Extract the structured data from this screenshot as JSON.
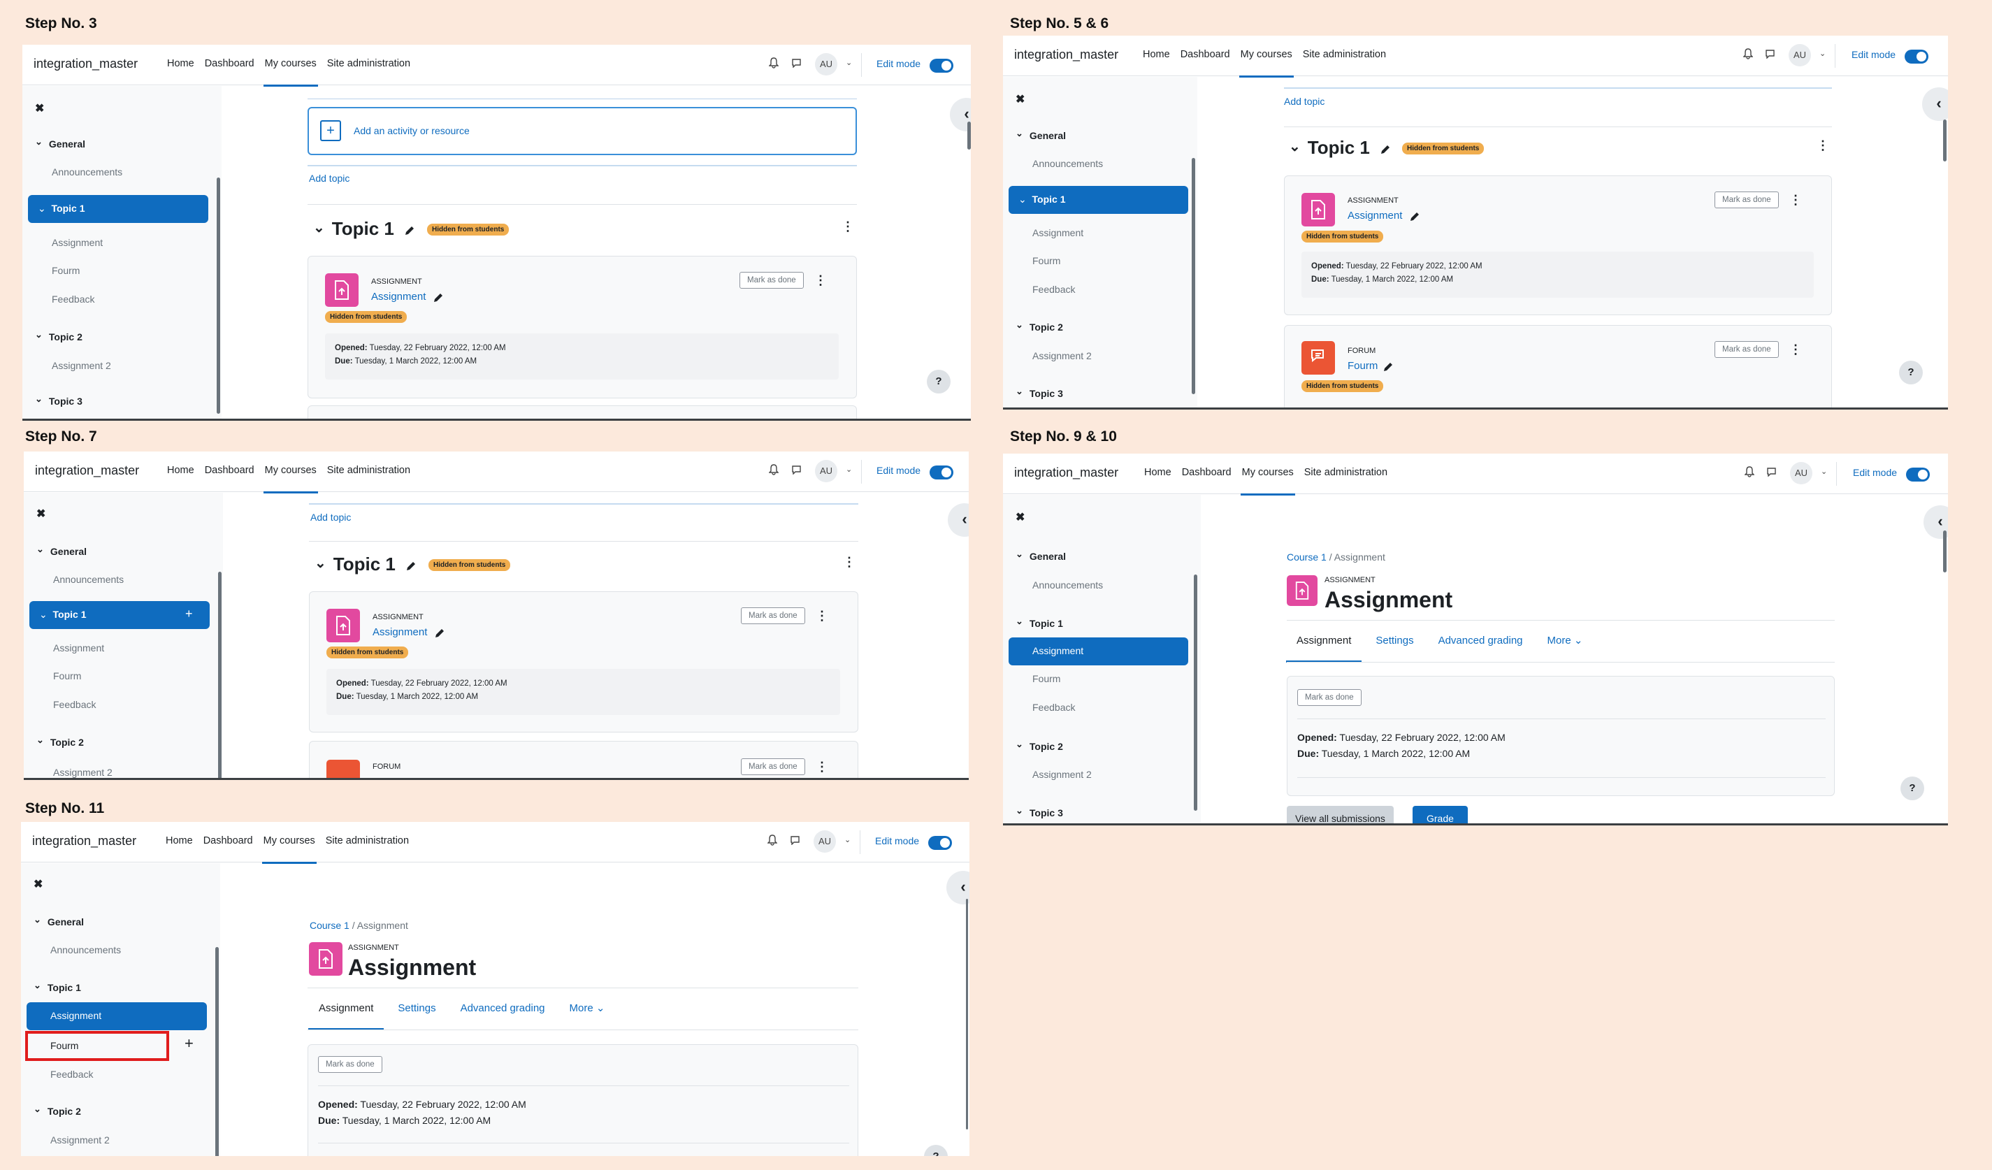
{
  "steps": [
    "Step No. 3",
    "Step No. 5 & 6",
    "Step No. 7",
    "Step No. 9 & 10",
    "Step No. 11"
  ],
  "nav": {
    "brand": "integration_master",
    "links": [
      "Home",
      "Dashboard",
      "My courses",
      "Site administration"
    ],
    "avatar": "AU",
    "edit_mode": "Edit mode"
  },
  "index": {
    "general": "General",
    "announcements": "Announcements",
    "topic1": "Topic 1",
    "assignment": "Assignment",
    "fourm": "Fourm",
    "feedback": "Feedback",
    "topic2": "Topic 2",
    "assignment2": "Assignment 2",
    "topic3": "Topic 3"
  },
  "course": {
    "add_activity": "Add an activity or resource",
    "add_topic": "Add topic",
    "topic_title": "Topic 1",
    "hidden": "Hidden from students",
    "assign_type": "ASSIGNMENT",
    "assign_name": "Assignment",
    "forum_type": "FORUM",
    "forum_name": "Fourm",
    "mark_done": "Mark as done",
    "opened_label": "Opened:",
    "opened": "Tuesday, 22 February 2022, 12:00 AM",
    "due_label": "Due:",
    "due": "Tuesday, 1 March 2022, 12:00 AM"
  },
  "assignment_page": {
    "crumb_course": "Course 1",
    "crumb_sep": "/",
    "crumb_current": "Assignment",
    "type": "ASSIGNMENT",
    "title": "Assignment",
    "tabs": [
      "Assignment",
      "Settings",
      "Advanced grading",
      "More ⌄"
    ],
    "view_all": "View all submissions",
    "grade": "Grade"
  },
  "icons": {
    "close": "close-icon",
    "collapse": "chevron-left-icon",
    "help": "question-icon",
    "bell": "bell-icon",
    "chat": "chat-icon",
    "edit": "pencil-icon",
    "menu": "kebab-icon"
  },
  "colors": {
    "primary": "#0f6cbf",
    "assignment_icon": "#e2499f",
    "forum_icon": "#eb5534",
    "badge": "#f0ad4e",
    "highlight": "#e01d1d",
    "background": "#fce9dc"
  }
}
